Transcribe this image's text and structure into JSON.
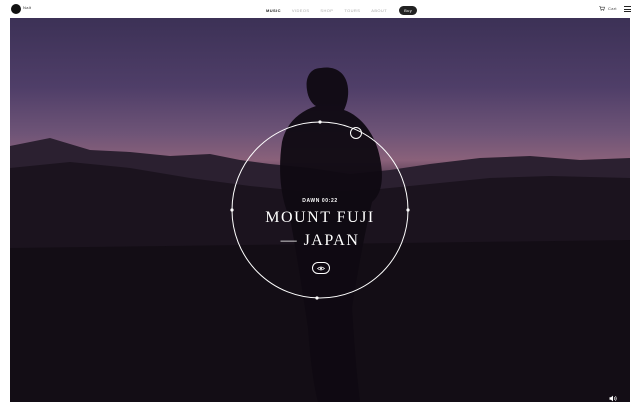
{
  "brand": {
    "name": "Nalt"
  },
  "nav": {
    "items": [
      {
        "label": "Music",
        "active": true
      },
      {
        "label": "Videos",
        "active": false
      },
      {
        "label": "Shop",
        "active": false
      },
      {
        "label": "Tours",
        "active": false
      },
      {
        "label": "About",
        "active": false
      }
    ],
    "pill_label": "Buy"
  },
  "cart": {
    "label": "Cart",
    "icon": "cart-icon"
  },
  "menu": {
    "icon": "hamburger-icon"
  },
  "hero": {
    "subtitle": "DAWN 00:22",
    "title_line1": "MOUNT FUJI",
    "title_line2": "— JAPAN",
    "view_icon": "eye-icon",
    "sound_icon": "speaker-icon"
  },
  "colors": {
    "sky_top": "#3c3156",
    "horizon": "#8a617a",
    "ground": "#150f17",
    "accent": "#ffffff"
  }
}
